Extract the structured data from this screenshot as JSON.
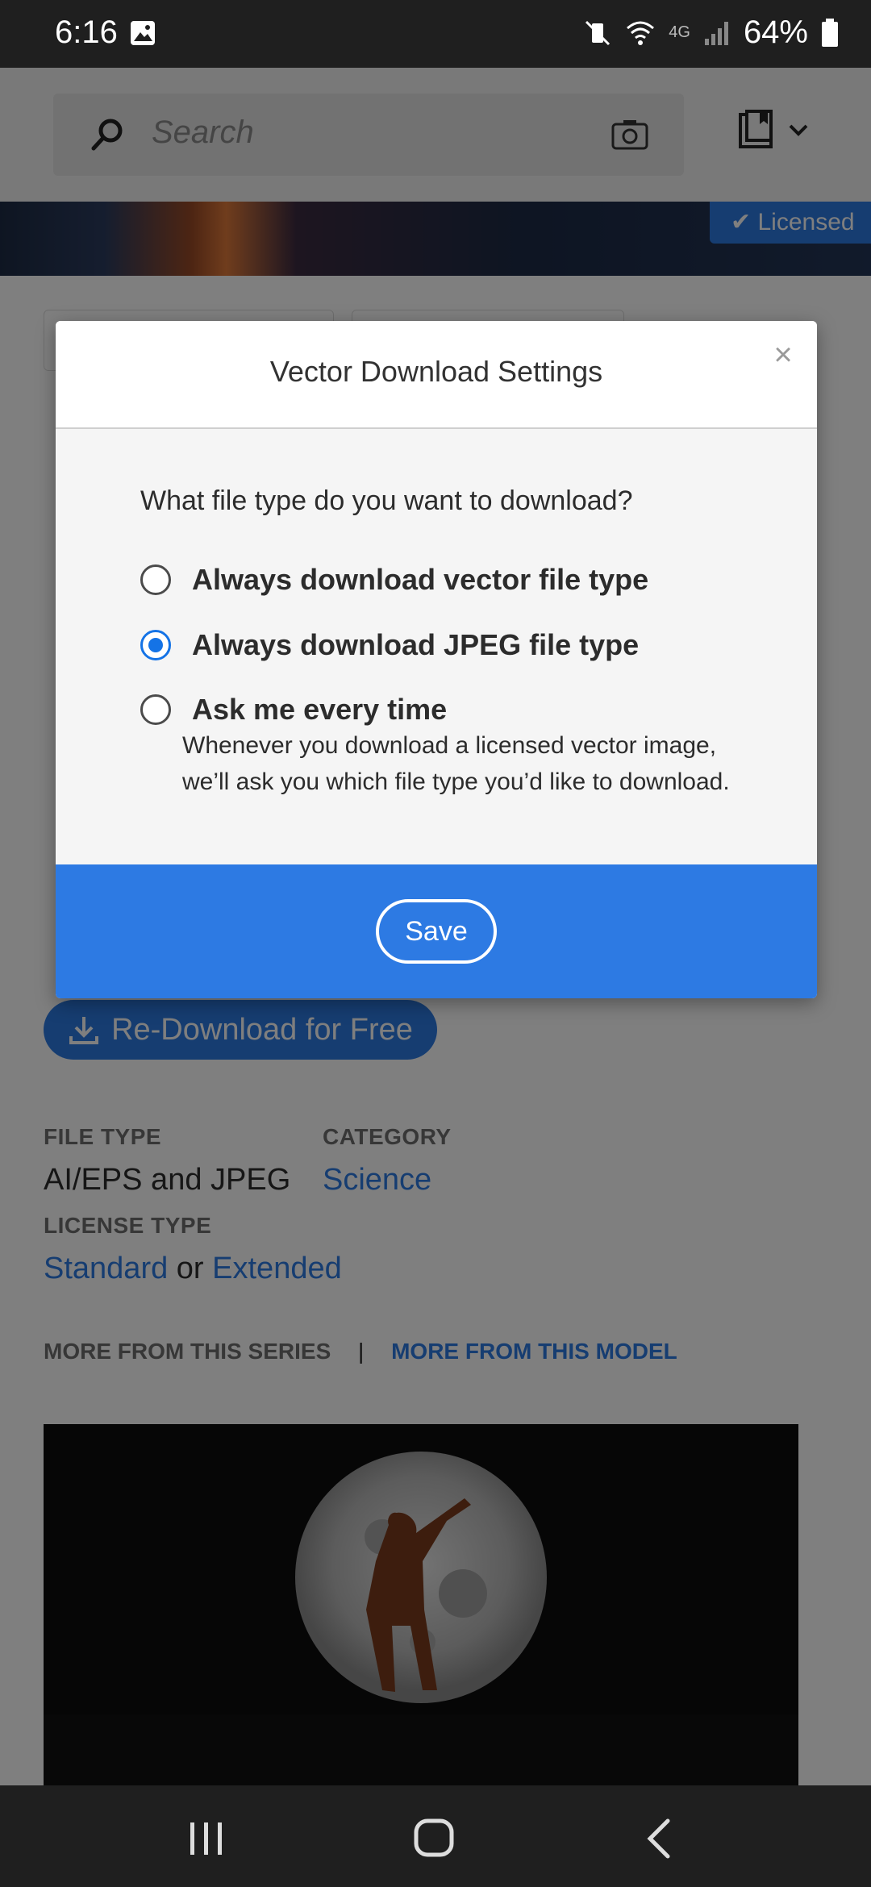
{
  "status_bar": {
    "time": "6:16",
    "network": "4G",
    "battery": "64%"
  },
  "header": {
    "search_placeholder": "Search"
  },
  "hero": {
    "licensed_label": "Licensed"
  },
  "page": {
    "redownload_label": "Re-Download for Free",
    "file_type_label": "FILE TYPE",
    "file_type_value": "AI/EPS and JPEG",
    "category_label": "CATEGORY",
    "category_value": "Science",
    "license_type_label": "LICENSE TYPE",
    "license_standard": "Standard",
    "license_or": "or",
    "license_extended": "Extended",
    "tab_series": "MORE FROM THIS SERIES",
    "tab_separator": "|",
    "tab_model": "MORE FROM THIS MODEL"
  },
  "modal": {
    "title": "Vector Download Settings",
    "close_glyph": "×",
    "question": "What file type do you want to download?",
    "options": [
      {
        "label": "Always download vector file type",
        "checked": false
      },
      {
        "label": "Always download JPEG file type",
        "checked": true
      },
      {
        "label": "Ask me every time",
        "checked": false
      }
    ],
    "ask_description": "Whenever you download a licensed vector image, we’ll ask you which file type you’d like to download.",
    "save_label": "Save"
  },
  "colors": {
    "accent": "#2d7ae3",
    "radio_selected": "#1473e6"
  }
}
